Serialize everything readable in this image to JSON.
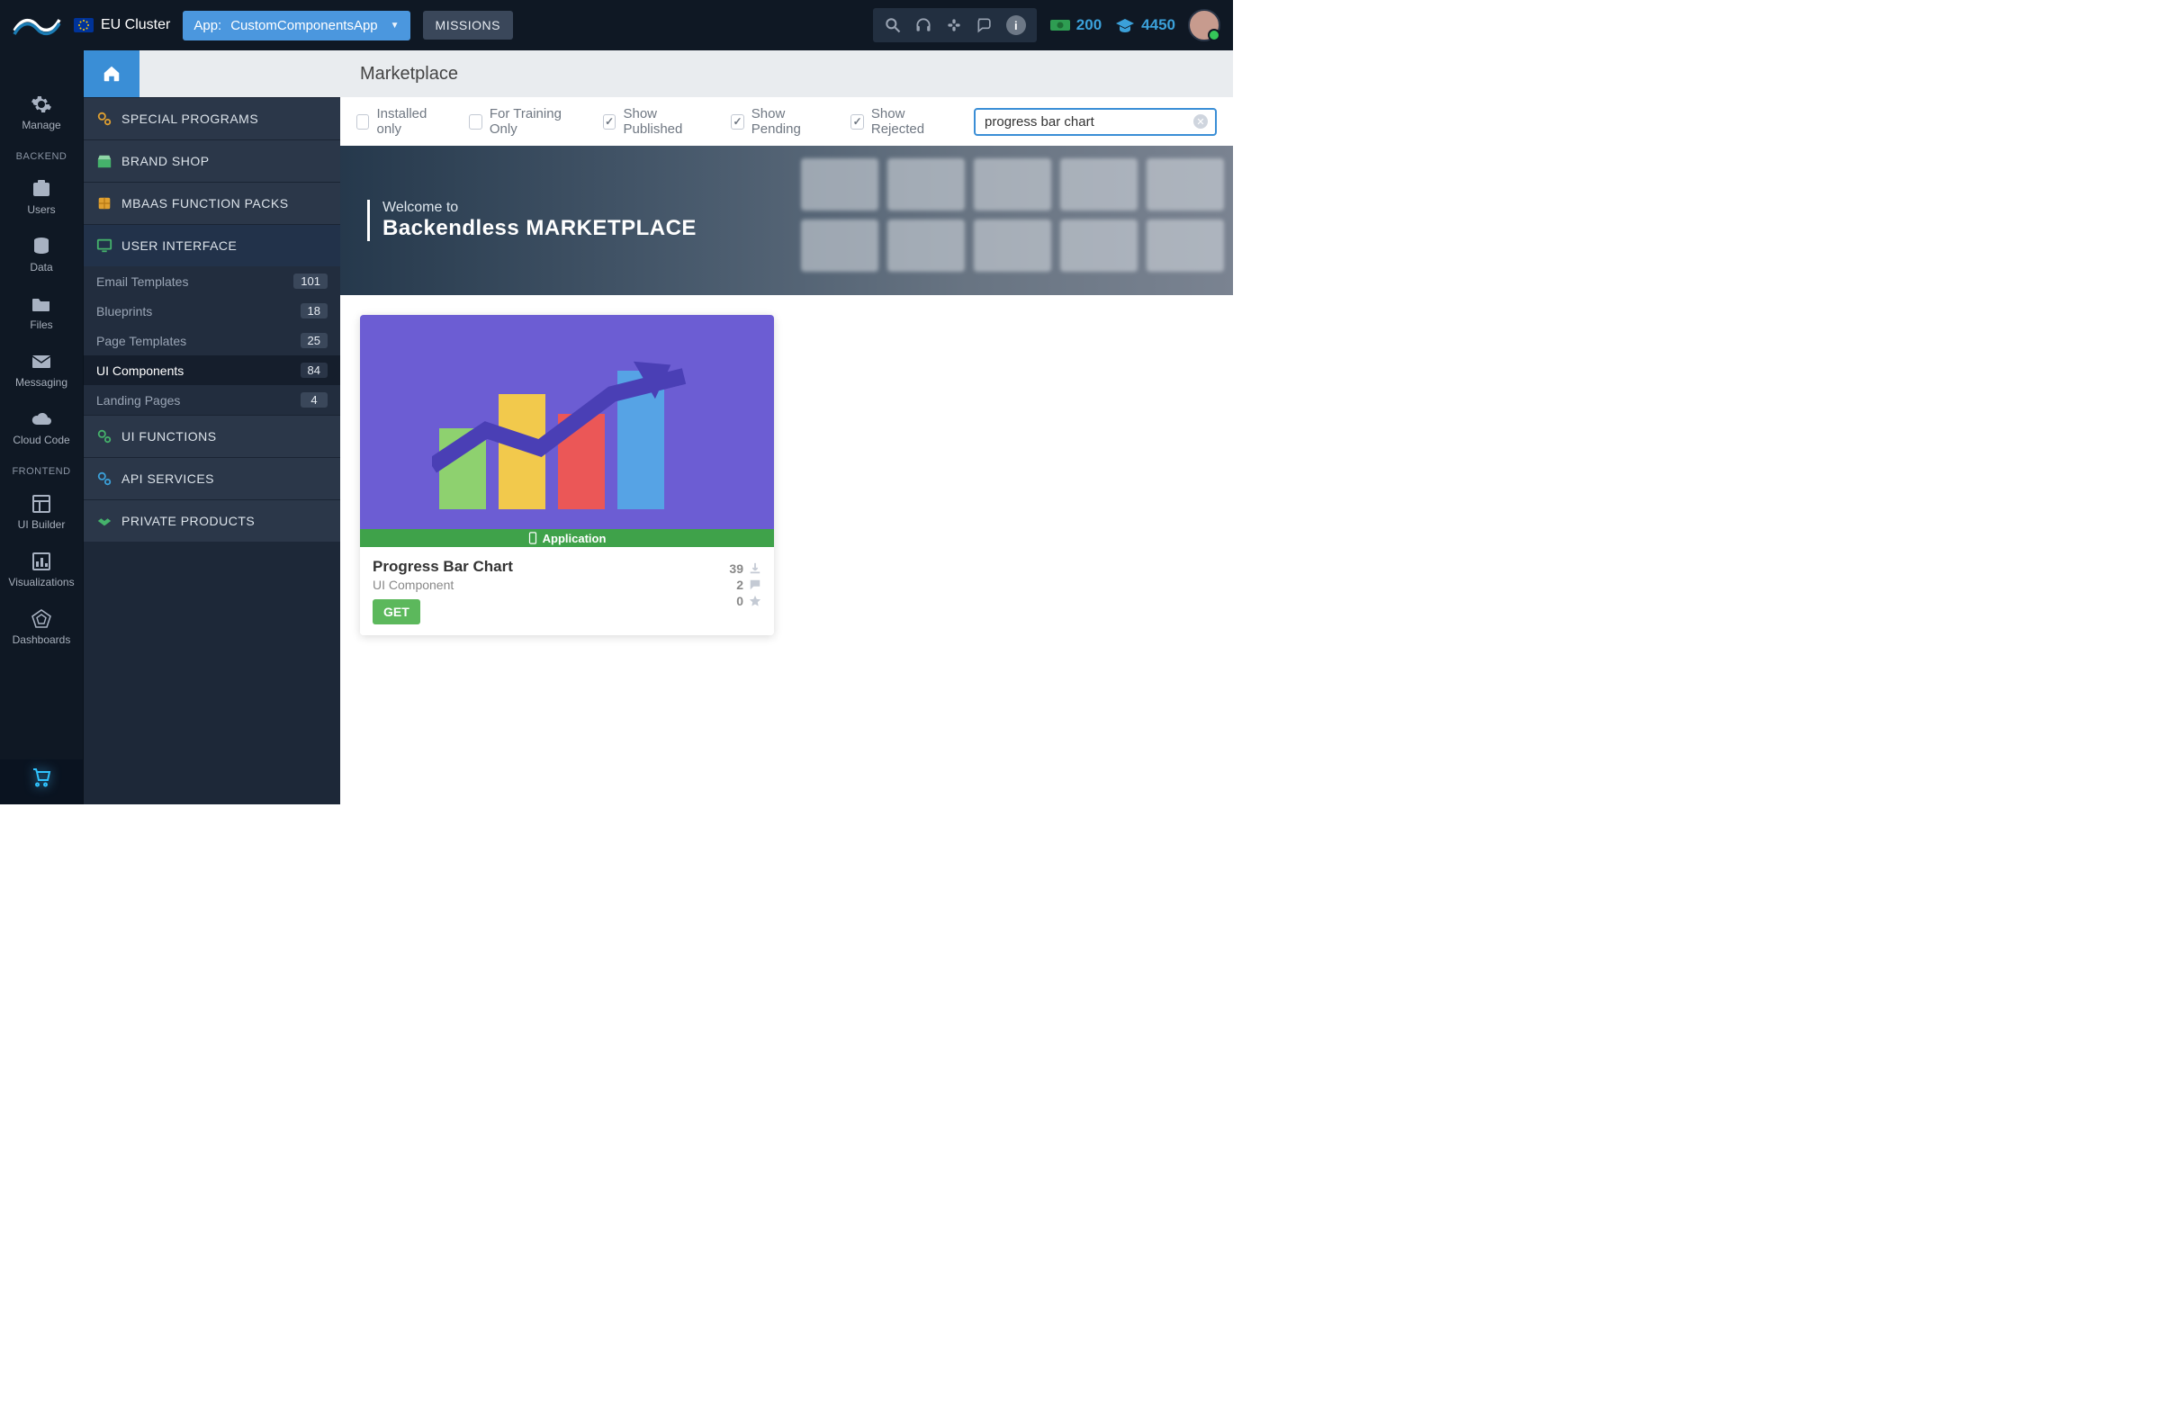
{
  "topbar": {
    "cluster_label": "EU Cluster",
    "app_selector_prefix": "App:",
    "app_selector_value": "CustomComponentsApp",
    "missions_label": "MISSIONS",
    "credits_cash": "200",
    "credits_grad": "4450"
  },
  "rail": {
    "backend_label": "BACKEND",
    "frontend_label": "FRONTEND",
    "items": {
      "manage": "Manage",
      "users": "Users",
      "data": "Data",
      "files": "Files",
      "messaging": "Messaging",
      "cloud": "Cloud Code",
      "builder": "UI Builder",
      "viz": "Visualizations",
      "dash": "Dashboards"
    }
  },
  "page_title": "Marketplace",
  "sections": {
    "special": "SPECIAL PROGRAMS",
    "brand": "BRAND SHOP",
    "mbaas": "MBAAS FUNCTION PACKS",
    "ui": "USER INTERFACE",
    "uifn": "UI FUNCTIONS",
    "api": "API SERVICES",
    "private": "PRIVATE PRODUCTS"
  },
  "ui_sublist": [
    {
      "label": "Email Templates",
      "count": "101"
    },
    {
      "label": "Blueprints",
      "count": "18"
    },
    {
      "label": "Page Templates",
      "count": "25"
    },
    {
      "label": "UI Components",
      "count": "84"
    },
    {
      "label": "Landing Pages",
      "count": "4"
    }
  ],
  "filters": {
    "installed": "Installed only",
    "training": "For Training Only",
    "published": "Show Published",
    "pending": "Show Pending",
    "rejected": "Show Rejected",
    "search_value": "progress bar chart"
  },
  "hero": {
    "small": "Welcome to",
    "big": "Backendless MARKETPLACE"
  },
  "product": {
    "strip_label": "Application",
    "title": "Progress Bar Chart",
    "subtitle": "UI Component",
    "get_label": "GET",
    "downloads": "39",
    "comments": "2",
    "stars": "0"
  }
}
